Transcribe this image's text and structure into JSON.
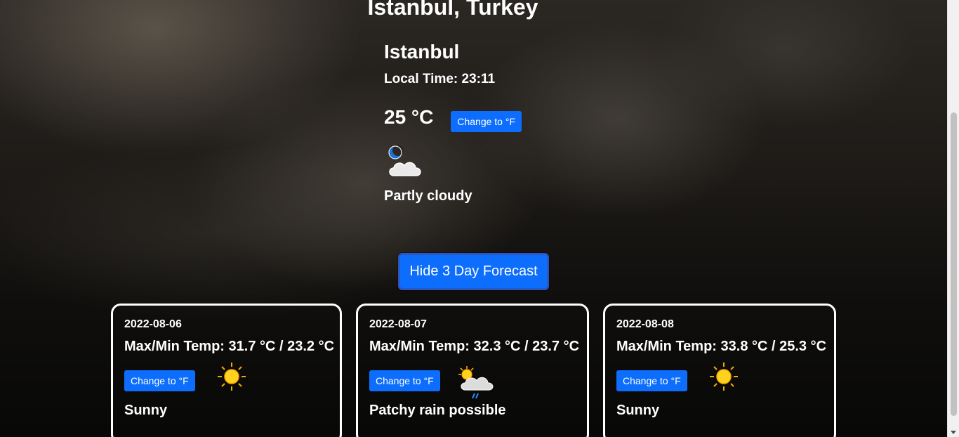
{
  "header": {
    "location": "Istanbul, Turkey"
  },
  "current": {
    "city": "Istanbul",
    "local_time": "Local Time: 23:11",
    "temperature": "25 °C",
    "unit_button": "Change to °F",
    "condition": "Partly cloudy",
    "icon": "partly-cloudy-night-icon"
  },
  "forecast_toggle": "Hide 3 Day Forecast",
  "forecast": [
    {
      "date": "2022-08-06",
      "temps": "Max/Min Temp: 31.7 °C / 23.2 °C",
      "unit_button": "Change to °F",
      "condition": "Sunny",
      "icon": "sun-icon"
    },
    {
      "date": "2022-08-07",
      "temps": "Max/Min Temp: 32.3 °C / 23.7 °C",
      "unit_button": "Change to °F",
      "condition": "Patchy rain possible",
      "icon": "patchy-rain-icon"
    },
    {
      "date": "2022-08-08",
      "temps": "Max/Min Temp: 33.8 °C / 25.3 °C",
      "unit_button": "Change to °F",
      "condition": "Sunny",
      "icon": "sun-icon"
    }
  ],
  "colors": {
    "accent": "#0d6efd",
    "text": "#ffffff"
  }
}
